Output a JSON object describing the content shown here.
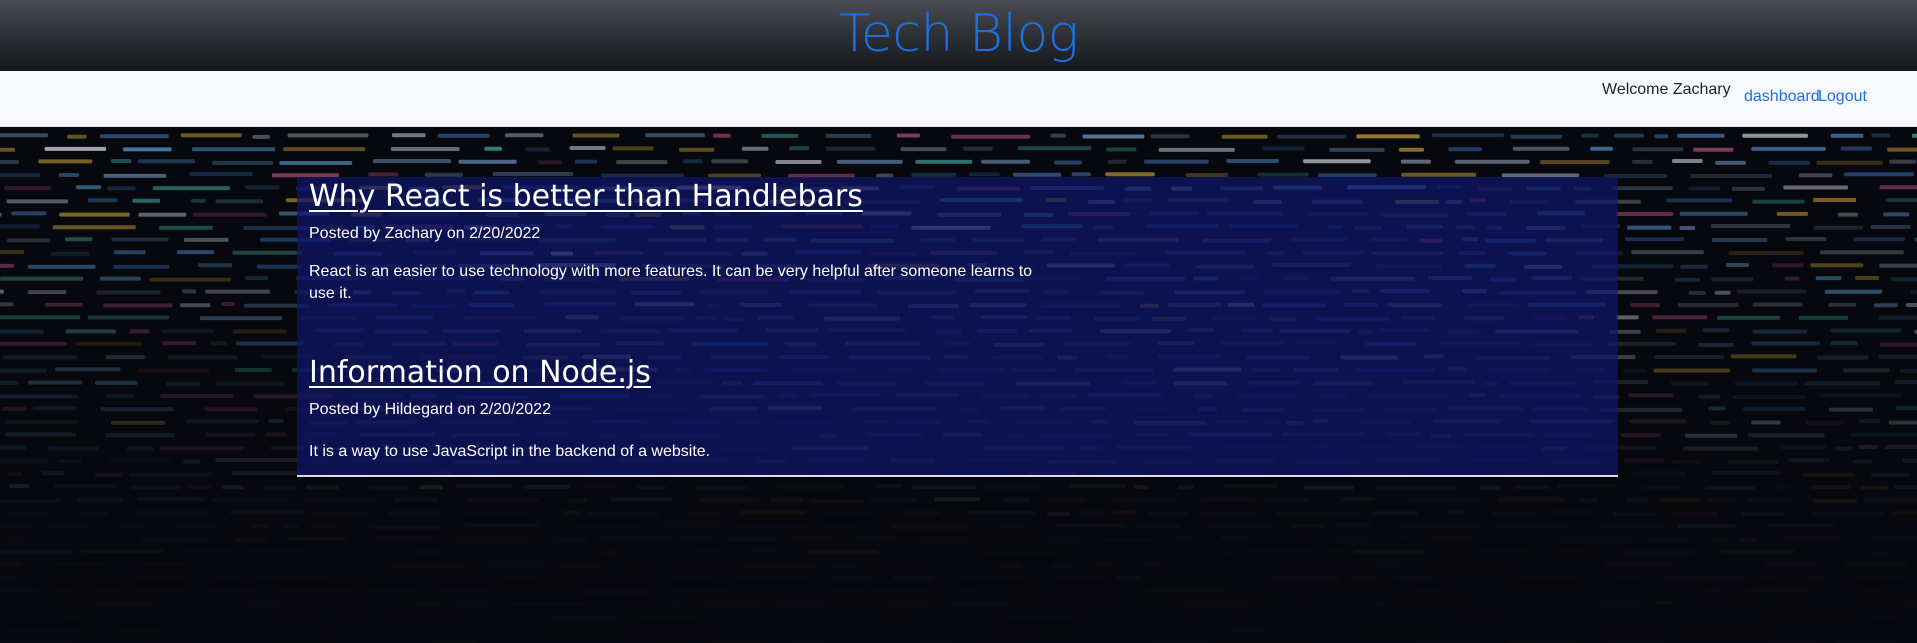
{
  "header": {
    "title": "Tech Blog"
  },
  "nav": {
    "welcome": "Welcome Zachary",
    "dashboard_label": "dashboard",
    "logout_label": "Logout"
  },
  "posts": [
    {
      "title": "Why React is better than Handlebars",
      "posted_by_prefix": "Posted by",
      "author": "Zachary",
      "on_word": "on",
      "date": "2/20/2022",
      "body": "React is an easier to use technology with more features. It can be very helpful after someone learns to use it."
    },
    {
      "title": "Information on Node.js",
      "posted_by_prefix": "Posted by",
      "author": "Hildegard",
      "on_word": "on",
      "date": "2/20/2022",
      "body": "It is a way to use JavaScript in the backend of a website."
    }
  ],
  "colors": {
    "brand": "#1e6fe0",
    "header_dark": "#15181b",
    "post_panel": "#0e166e"
  }
}
